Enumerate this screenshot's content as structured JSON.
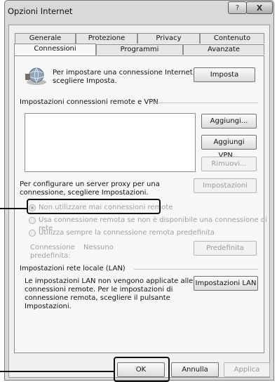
{
  "window": {
    "title": "Opzioni Internet",
    "help_glyph": "?",
    "close_glyph": "X"
  },
  "tabs": [
    {
      "label": "Generale"
    },
    {
      "label": "Protezione"
    },
    {
      "label": "Privacy"
    },
    {
      "label": "Contenuto"
    },
    {
      "label": "Connessioni"
    },
    {
      "label": "Programmi"
    },
    {
      "label": "Avanzate"
    }
  ],
  "active_tab": "Connessioni",
  "setup": {
    "text_line1": "Per impostare una connessione Internet,",
    "text_line2": "scegliere Imposta.",
    "button": "Imposta",
    "icon": "network-globe-icon"
  },
  "vpn": {
    "header": "Impostazioni connessioni remote e VPN",
    "add_button": "Aggiungi...",
    "add_vpn_button": "Aggiungi VPN...",
    "remove_button": "Rimuovi...",
    "proxy_text_line1": "Per configurare un server proxy per una",
    "proxy_text_line2": "connessione, scegliere Impostazioni.",
    "settings_button": "Impostazioni"
  },
  "radios": [
    {
      "label": "Non utilizzare mai connessioni remote",
      "checked": true
    },
    {
      "label": "Usa connessione remota se non è disponibile una connessione di rete",
      "checked": false
    },
    {
      "label": "Utilizza sempre la connessione remota predefinita",
      "checked": false
    }
  ],
  "default_conn": {
    "label_line1": "Connessione",
    "label_line2": "predefinita:",
    "value": "Nessuno",
    "button": "Predefinita"
  },
  "lan": {
    "header": "Impostazioni rete locale (LAN)",
    "text_line1": "Le impostazioni LAN non vengono applicate alle",
    "text_line2": "connessioni remote. Per le impostazioni di",
    "text_line3": "connessione remota, scegliere il pulsante",
    "text_line4": "Impostazioni.",
    "button": "Impostazioni LAN"
  },
  "footer": {
    "ok": "OK",
    "cancel": "Annulla",
    "apply": "Applica"
  }
}
